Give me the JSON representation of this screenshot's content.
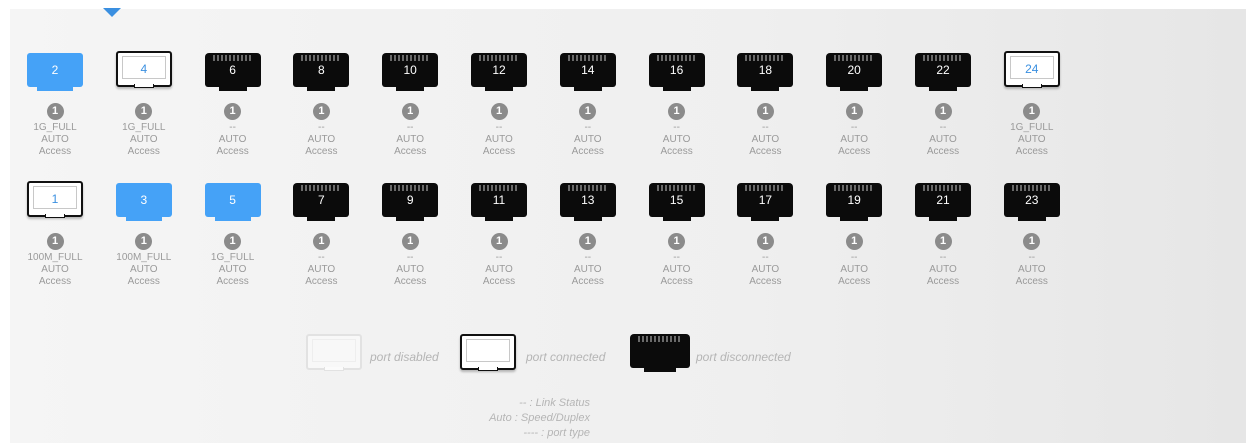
{
  "ports_top": [
    {
      "n": "2",
      "type": "blue",
      "status": "1G_FULL",
      "speed": "AUTO",
      "mode": "Access"
    },
    {
      "n": "4",
      "type": "conn",
      "status": "1G_FULL",
      "speed": "AUTO",
      "mode": "Access"
    },
    {
      "n": "6",
      "type": "disc",
      "status": "--",
      "speed": "AUTO",
      "mode": "Access"
    },
    {
      "n": "8",
      "type": "disc",
      "status": "--",
      "speed": "AUTO",
      "mode": "Access"
    },
    {
      "n": "10",
      "type": "disc",
      "status": "--",
      "speed": "AUTO",
      "mode": "Access"
    },
    {
      "n": "12",
      "type": "disc",
      "status": "--",
      "speed": "AUTO",
      "mode": "Access"
    },
    {
      "n": "14",
      "type": "disc",
      "status": "--",
      "speed": "AUTO",
      "mode": "Access"
    },
    {
      "n": "16",
      "type": "disc",
      "status": "--",
      "speed": "AUTO",
      "mode": "Access"
    },
    {
      "n": "18",
      "type": "disc",
      "status": "--",
      "speed": "AUTO",
      "mode": "Access"
    },
    {
      "n": "20",
      "type": "disc",
      "status": "--",
      "speed": "AUTO",
      "mode": "Access"
    },
    {
      "n": "22",
      "type": "disc",
      "status": "--",
      "speed": "AUTO",
      "mode": "Access"
    },
    {
      "n": "24",
      "type": "conn",
      "status": "1G_FULL",
      "speed": "AUTO",
      "mode": "Access"
    }
  ],
  "ports_bottom": [
    {
      "n": "1",
      "type": "conn",
      "status": "100M_FULL",
      "speed": "AUTO",
      "mode": "Access"
    },
    {
      "n": "3",
      "type": "blue",
      "status": "100M_FULL",
      "speed": "AUTO",
      "mode": "Access"
    },
    {
      "n": "5",
      "type": "blue",
      "status": "1G_FULL",
      "speed": "AUTO",
      "mode": "Access"
    },
    {
      "n": "7",
      "type": "disc",
      "status": "--",
      "speed": "AUTO",
      "mode": "Access"
    },
    {
      "n": "9",
      "type": "disc",
      "status": "--",
      "speed": "AUTO",
      "mode": "Access"
    },
    {
      "n": "11",
      "type": "disc",
      "status": "--",
      "speed": "AUTO",
      "mode": "Access"
    },
    {
      "n": "13",
      "type": "disc",
      "status": "--",
      "speed": "AUTO",
      "mode": "Access"
    },
    {
      "n": "15",
      "type": "disc",
      "status": "--",
      "speed": "AUTO",
      "mode": "Access"
    },
    {
      "n": "17",
      "type": "disc",
      "status": "--",
      "speed": "AUTO",
      "mode": "Access"
    },
    {
      "n": "19",
      "type": "disc",
      "status": "--",
      "speed": "AUTO",
      "mode": "Access"
    },
    {
      "n": "21",
      "type": "disc",
      "status": "--",
      "speed": "AUTO",
      "mode": "Access"
    },
    {
      "n": "23",
      "type": "disc",
      "status": "--",
      "speed": "AUTO",
      "mode": "Access"
    }
  ],
  "badge_label": "1",
  "legend": {
    "disabled": "port disabled",
    "connected": "port connected",
    "disconnected": "port disconnected"
  },
  "notes": {
    "line1": "-- : Link Status",
    "line2": "Auto : Speed/Duplex",
    "line3": "---- : port type"
  },
  "colors": {
    "active_blue": "#45a2f7",
    "pointer_blue": "#3a8fe0"
  }
}
